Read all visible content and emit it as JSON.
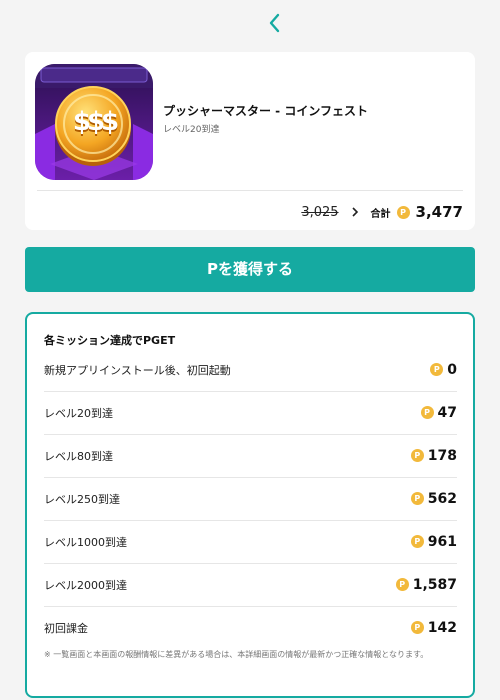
{
  "nav": {
    "back_icon": "chevron-left-icon"
  },
  "app": {
    "name": "プッシャーマスター - コインフェスト",
    "subtitle": "レベル20到達",
    "icon_text": "$$$",
    "old_price": "3,025",
    "total_label": "合計",
    "total_value": "3,477",
    "coin_symbol": "P"
  },
  "cta": {
    "label": "Pを獲得する"
  },
  "missions": {
    "title": "各ミッション達成でPGET",
    "items": [
      {
        "label": "新規アプリインストール後、初回起動",
        "points": "0"
      },
      {
        "label": "レベル20到達",
        "points": "47"
      },
      {
        "label": "レベル80到達",
        "points": "178"
      },
      {
        "label": "レベル250到達",
        "points": "562"
      },
      {
        "label": "レベル1000到達",
        "points": "961"
      },
      {
        "label": "レベル2000到達",
        "points": "1,587"
      },
      {
        "label": "初回課金",
        "points": "142"
      }
    ],
    "note": "※ 一覧画面と本画面の報酬情報に差異がある場合は、本詳細画面の情報が最新かつ正確な情報となります。"
  },
  "colors": {
    "accent": "#15aaa1",
    "coin": "#f2b93b",
    "background": "#f4f4f4"
  }
}
